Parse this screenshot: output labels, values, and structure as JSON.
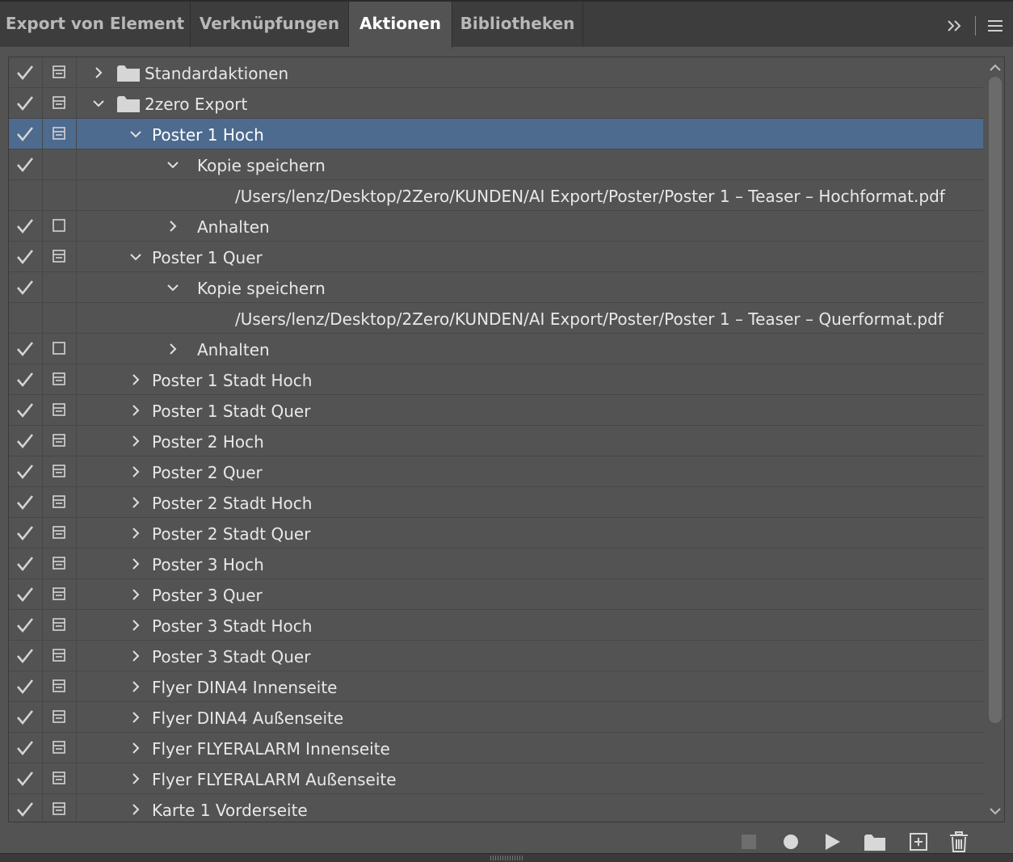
{
  "tabs": [
    {
      "label": "Export von Element",
      "active": false
    },
    {
      "label": "Verknüpfungen",
      "active": false
    },
    {
      "label": "Aktionen",
      "active": true
    },
    {
      "label": "Bibliotheken",
      "active": false
    }
  ],
  "rows": [
    {
      "check": true,
      "dialog": "box",
      "level": 0,
      "expanded": false,
      "folder": true,
      "label": "Standardaktionen",
      "selected": false
    },
    {
      "check": true,
      "dialog": "box",
      "level": 0,
      "expanded": true,
      "folder": true,
      "label": "2zero Export",
      "selected": false
    },
    {
      "check": true,
      "dialog": "box",
      "level": 1,
      "expanded": true,
      "folder": false,
      "label": "Poster 1 Hoch",
      "selected": true
    },
    {
      "check": true,
      "dialog": "none",
      "level": 2,
      "expanded": true,
      "folder": false,
      "label": "Kopie speichern",
      "selected": false
    },
    {
      "check": false,
      "dialog": "none",
      "level": 3,
      "expanded": null,
      "folder": false,
      "label": "/Users/lenz/Desktop/2Zero/KUNDEN/AI Export/Poster/Poster 1 – Teaser – Hochformat.pdf",
      "selected": false
    },
    {
      "check": true,
      "dialog": "empty",
      "level": 2,
      "expanded": false,
      "folder": false,
      "label": "Anhalten",
      "selected": false
    },
    {
      "check": true,
      "dialog": "box",
      "level": 1,
      "expanded": true,
      "folder": false,
      "label": "Poster 1 Quer",
      "selected": false
    },
    {
      "check": true,
      "dialog": "none",
      "level": 2,
      "expanded": true,
      "folder": false,
      "label": "Kopie speichern",
      "selected": false
    },
    {
      "check": false,
      "dialog": "none",
      "level": 3,
      "expanded": null,
      "folder": false,
      "label": "/Users/lenz/Desktop/2Zero/KUNDEN/AI Export/Poster/Poster 1 – Teaser – Querformat.pdf",
      "selected": false
    },
    {
      "check": true,
      "dialog": "empty",
      "level": 2,
      "expanded": false,
      "folder": false,
      "label": "Anhalten",
      "selected": false
    },
    {
      "check": true,
      "dialog": "box",
      "level": 1,
      "expanded": false,
      "folder": false,
      "label": "Poster 1 Stadt Hoch",
      "selected": false
    },
    {
      "check": true,
      "dialog": "box",
      "level": 1,
      "expanded": false,
      "folder": false,
      "label": "Poster 1 Stadt Quer",
      "selected": false
    },
    {
      "check": true,
      "dialog": "box",
      "level": 1,
      "expanded": false,
      "folder": false,
      "label": "Poster 2 Hoch",
      "selected": false
    },
    {
      "check": true,
      "dialog": "box",
      "level": 1,
      "expanded": false,
      "folder": false,
      "label": "Poster 2 Quer",
      "selected": false
    },
    {
      "check": true,
      "dialog": "box",
      "level": 1,
      "expanded": false,
      "folder": false,
      "label": "Poster 2 Stadt Hoch",
      "selected": false
    },
    {
      "check": true,
      "dialog": "box",
      "level": 1,
      "expanded": false,
      "folder": false,
      "label": "Poster 2 Stadt Quer",
      "selected": false
    },
    {
      "check": true,
      "dialog": "box",
      "level": 1,
      "expanded": false,
      "folder": false,
      "label": "Poster 3 Hoch",
      "selected": false
    },
    {
      "check": true,
      "dialog": "box",
      "level": 1,
      "expanded": false,
      "folder": false,
      "label": "Poster 3 Quer",
      "selected": false
    },
    {
      "check": true,
      "dialog": "box",
      "level": 1,
      "expanded": false,
      "folder": false,
      "label": "Poster 3 Stadt Hoch",
      "selected": false
    },
    {
      "check": true,
      "dialog": "box",
      "level": 1,
      "expanded": false,
      "folder": false,
      "label": "Poster 3 Stadt Quer",
      "selected": false
    },
    {
      "check": true,
      "dialog": "box",
      "level": 1,
      "expanded": false,
      "folder": false,
      "label": "Flyer DINA4 Innenseite",
      "selected": false
    },
    {
      "check": true,
      "dialog": "box",
      "level": 1,
      "expanded": false,
      "folder": false,
      "label": "Flyer DINA4 Außenseite",
      "selected": false
    },
    {
      "check": true,
      "dialog": "box",
      "level": 1,
      "expanded": false,
      "folder": false,
      "label": "Flyer FLYERALARM Innenseite",
      "selected": false
    },
    {
      "check": true,
      "dialog": "box",
      "level": 1,
      "expanded": false,
      "folder": false,
      "label": "Flyer FLYERALARM Außenseite",
      "selected": false
    },
    {
      "check": true,
      "dialog": "box",
      "level": 1,
      "expanded": false,
      "folder": false,
      "label": "Karte 1 Vorderseite",
      "selected": false
    }
  ],
  "bottom_buttons": [
    {
      "icon": "stop-icon",
      "enabled": false
    },
    {
      "icon": "record-icon",
      "enabled": true
    },
    {
      "icon": "play-icon",
      "enabled": true
    },
    {
      "icon": "folder-icon",
      "enabled": true
    },
    {
      "icon": "new-action-icon",
      "enabled": true
    },
    {
      "icon": "trash-icon",
      "enabled": true
    }
  ],
  "colors": {
    "panel": "#535353",
    "tabbar": "#3d3d3d",
    "selection": "#4d6a8f",
    "text": "#e8e8e8"
  }
}
